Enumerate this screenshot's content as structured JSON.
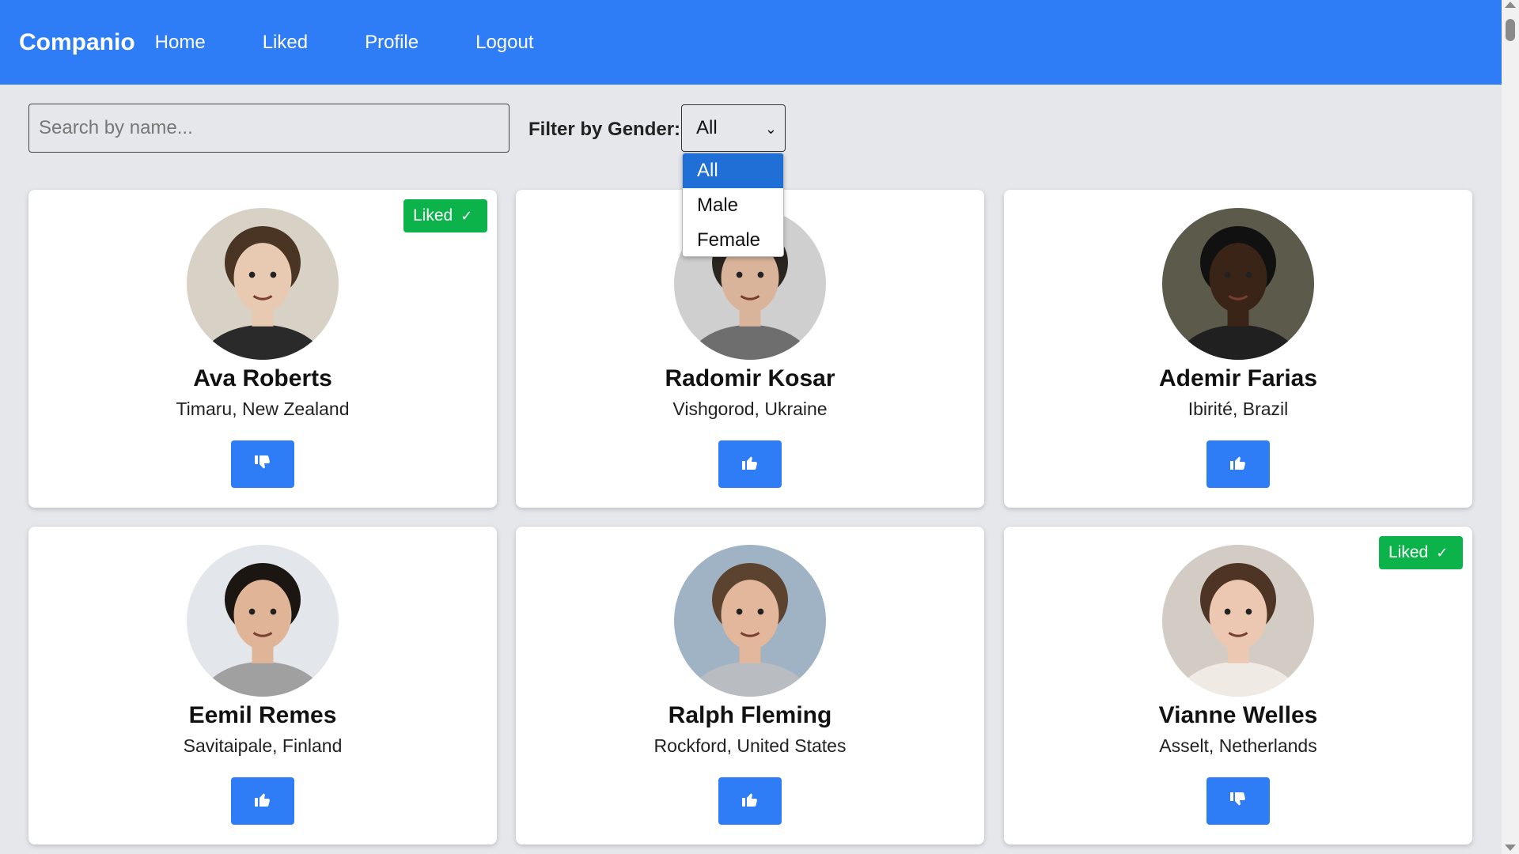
{
  "nav": {
    "brand": "Companio",
    "links": [
      "Home",
      "Liked",
      "Profile",
      "Logout"
    ]
  },
  "search": {
    "placeholder": "Search by name..."
  },
  "filter": {
    "label": "Filter by Gender:",
    "selected": "All",
    "options": [
      "All",
      "Male",
      "Female"
    ]
  },
  "badge": {
    "liked": "Liked"
  },
  "cards": [
    {
      "name": "Ava Roberts",
      "location": "Timaru, New Zealand",
      "liked": true,
      "action": "unlike",
      "skin": "#e8c9b2",
      "hair": "#4a3524",
      "shirt": "#2a2a2a",
      "bg": "#d8d2c6"
    },
    {
      "name": "Radomir Kosar",
      "location": "Vishgorod, Ukraine",
      "liked": false,
      "action": "like",
      "skin": "#d9b49a",
      "hair": "#2b2520",
      "shirt": "#6e6e6e",
      "bg": "#cfcfcf"
    },
    {
      "name": "Ademir Farias",
      "location": "Ibirité, Brazil",
      "liked": false,
      "action": "like",
      "skin": "#3a2418",
      "hair": "#111111",
      "shirt": "#202020",
      "bg": "#5c5a4a"
    },
    {
      "name": "Eemil Remes",
      "location": "Savitaipale, Finland",
      "liked": false,
      "action": "like",
      "skin": "#e0b497",
      "hair": "#1c1612",
      "shirt": "#a0a0a0",
      "bg": "#e3e6ea"
    },
    {
      "name": "Ralph Fleming",
      "location": "Rockford, United States",
      "liked": false,
      "action": "like",
      "skin": "#e2b79c",
      "hair": "#5b4330",
      "shirt": "#b9bcc0",
      "bg": "#9fb3c4"
    },
    {
      "name": "Vianne Welles",
      "location": "Asselt, Netherlands",
      "liked": true,
      "action": "unlike",
      "skin": "#ecc8b3",
      "hair": "#4e3424",
      "shirt": "#efeae4",
      "bg": "#d3ccc4"
    }
  ]
}
